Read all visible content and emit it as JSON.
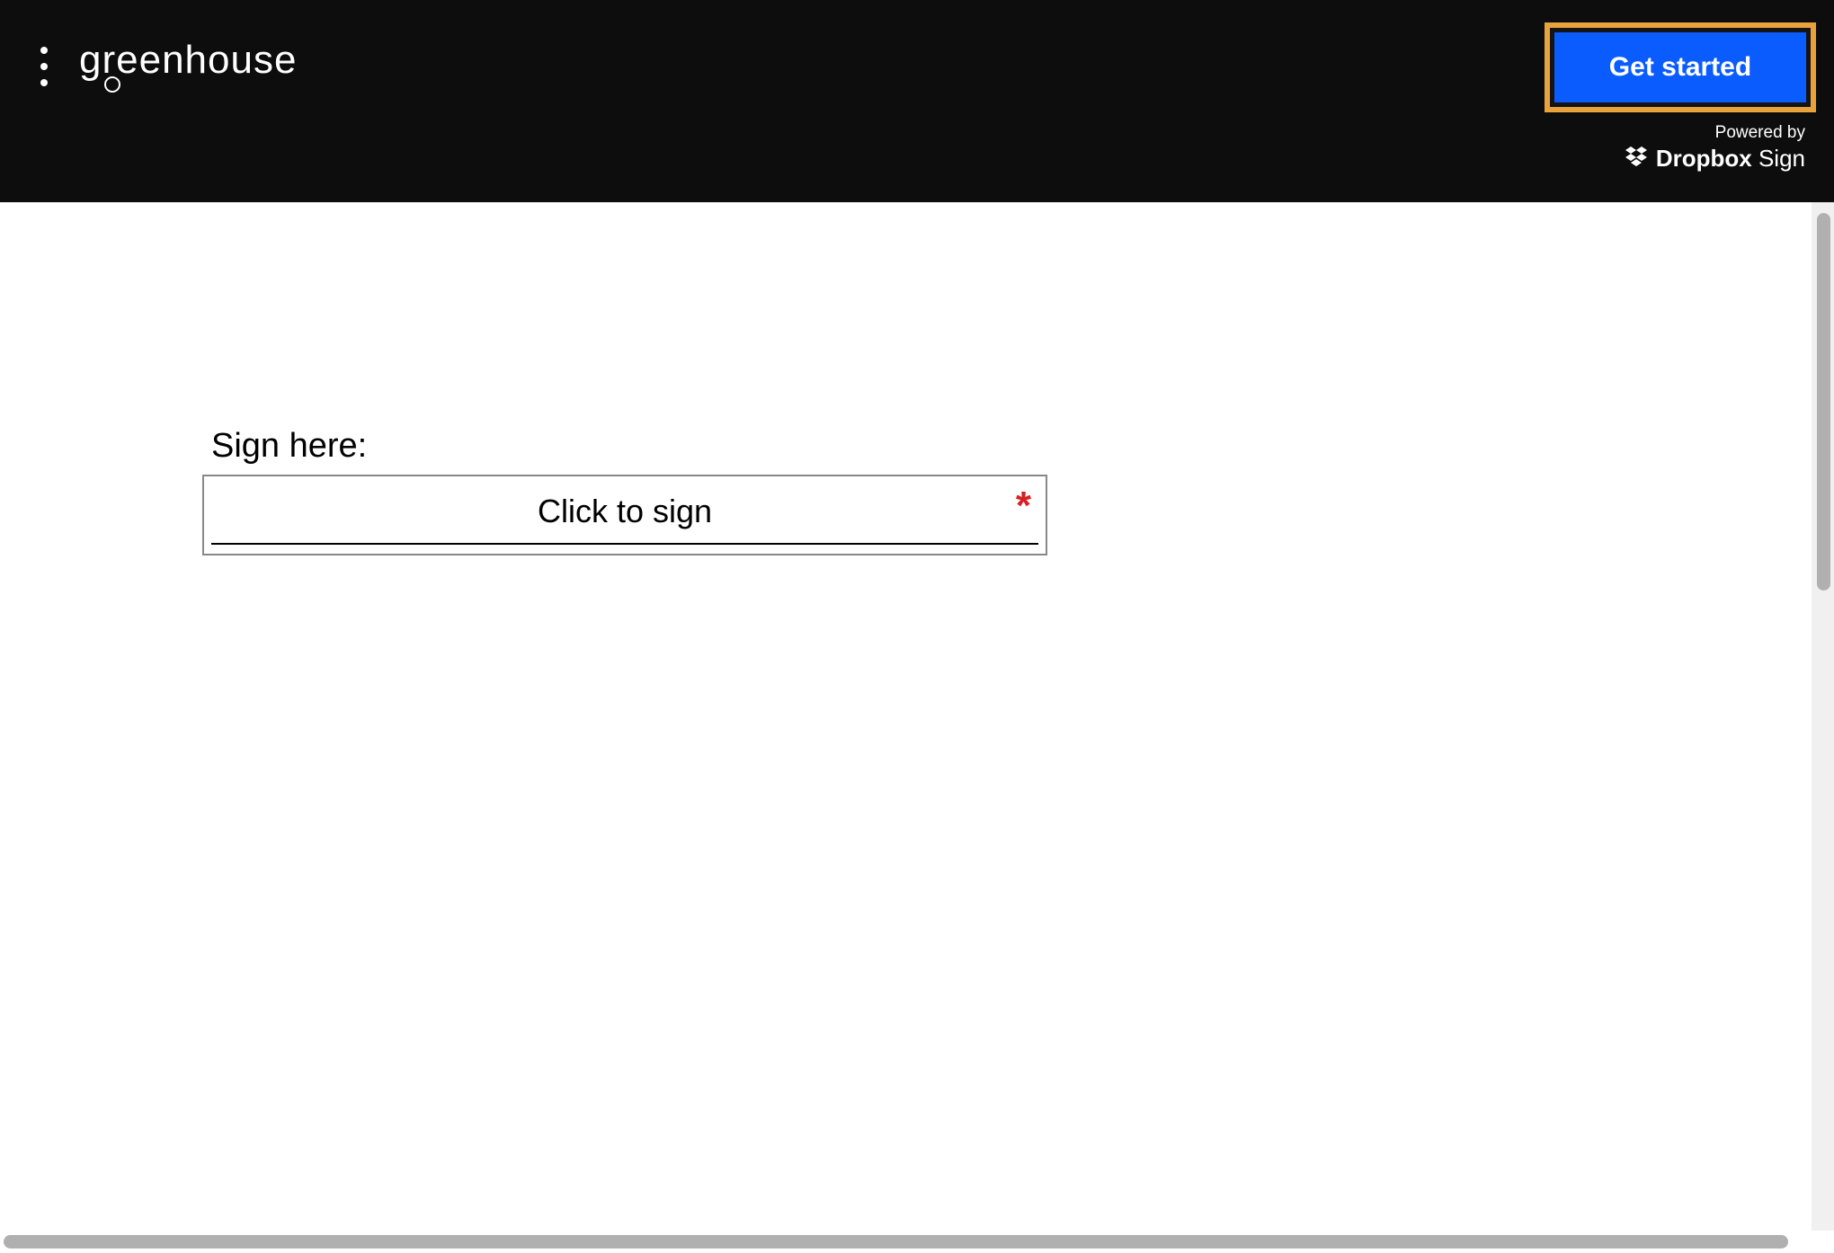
{
  "header": {
    "logo_text": "greenhouse",
    "cta_label": "Get started",
    "powered_by_label": "Powered by",
    "provider_name_bold": "Dropbox",
    "provider_name_light": "Sign"
  },
  "signing": {
    "label": "Sign here:",
    "placeholder": "Click to sign",
    "required_mark": "*"
  },
  "colors": {
    "header_bg": "#0d0d0d",
    "cta_bg": "#0b5cff",
    "highlight_border": "#e8a33d",
    "required": "#d62020"
  }
}
